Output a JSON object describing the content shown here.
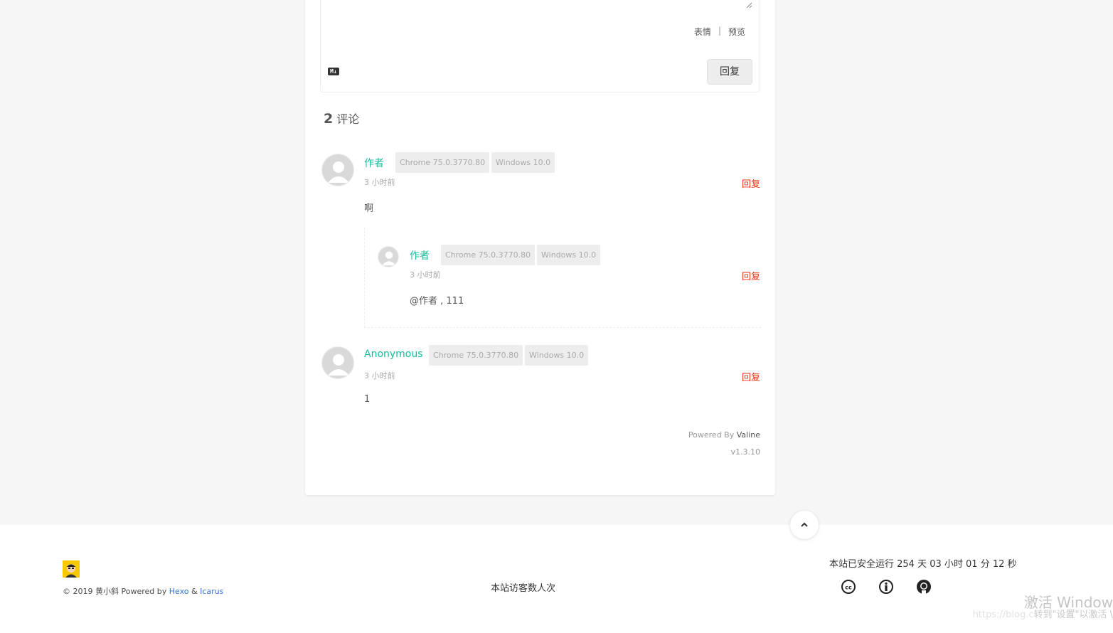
{
  "editor": {
    "emoji_label": "表情",
    "separator": "|",
    "preview_label": "预览",
    "markdown_badge": "M↓",
    "reply_button": "回复"
  },
  "comments_header": {
    "count": "2",
    "label": "评论"
  },
  "comments": [
    {
      "nick": "作者",
      "browser": "Chrome 75.0.3770.80",
      "os": "Windows 10.0",
      "time": "3 小时前",
      "reply": "回复",
      "content": "啊",
      "children": [
        {
          "nick": "作者",
          "browser": "Chrome 75.0.3770.80",
          "os": "Windows 10.0",
          "time": "3 小时前",
          "reply": "回复",
          "content": "@作者 , 111"
        }
      ]
    },
    {
      "nick": "Anonymous",
      "browser": "Chrome 75.0.3770.80",
      "os": "Windows 10.0",
      "time": "3 小时前",
      "reply": "回复",
      "content": "1"
    }
  ],
  "powered": {
    "prefix": "Powered By",
    "name": "Valine",
    "version": "v1.3.10"
  },
  "footer": {
    "copyright_text": "© 2019 黄小斜  Powered by",
    "hexo": "Hexo",
    "amp": "&",
    "icarus": "Icarus",
    "visitors": "本站访客数人次",
    "runtime": "本站已安全运行 254 天 03 小时 01 分 12 秒",
    "icons": [
      "creative-commons-icon",
      "attribution-icon",
      "github-icon"
    ]
  },
  "watermark": {
    "title": "激活 Window",
    "subtitle": "转到\"设置\"以激活 \\",
    "url": "https://blog.c"
  },
  "colors": {
    "nick": "#1abc9c",
    "reply": "#ef2f11",
    "link": "#3273dc"
  }
}
